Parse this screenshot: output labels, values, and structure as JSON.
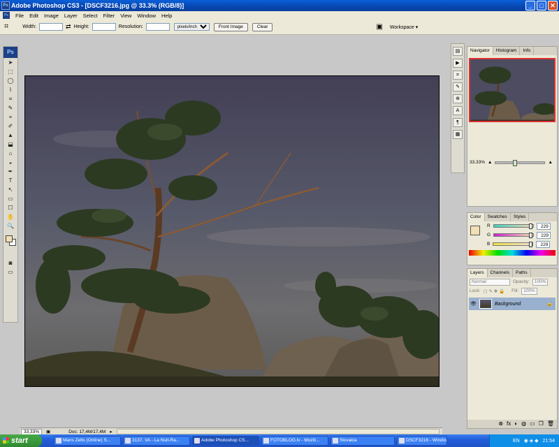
{
  "window": {
    "title": "Adobe Photoshop CS3 - [DSCF3216.jpg @ 33.3% (RGB/8)]",
    "min": "_",
    "max": "□",
    "close": "✕",
    "app_icon": "Ps"
  },
  "menu": [
    "File",
    "Edit",
    "Image",
    "Layer",
    "Select",
    "Filter",
    "View",
    "Window",
    "Help"
  ],
  "options": {
    "width_label": "Width:",
    "height_label": "Height:",
    "resolution_label": "Resolution:",
    "units": "pixels/inch",
    "front_image": "Front Image",
    "clear": "Clear",
    "workspace": "Workspace ▾"
  },
  "toolbox": {
    "logo": "Ps",
    "tools": [
      "➤",
      "⬚",
      "◯",
      "⌇",
      "⌗",
      "✎",
      "⌖",
      "✐",
      "▲",
      "⬓",
      "⌂",
      "◒",
      "✒",
      "T",
      "↖",
      "▭",
      "☐",
      "✋",
      "🔍"
    ]
  },
  "navigator": {
    "tabs": [
      "Navigator",
      "Histogram",
      "Info"
    ],
    "zoom": "33.33%",
    "zoom_fraction": 0.35
  },
  "color": {
    "tabs": [
      "Color",
      "Swatches",
      "Styles"
    ],
    "fg": "#f2dfb3",
    "channels": [
      {
        "label": "R",
        "value": "229",
        "fraction": 0.9,
        "gradient": "linear-gradient(90deg,#3fd3c2,#f0d8b0)"
      },
      {
        "label": "G",
        "value": "229",
        "fraction": 0.9,
        "gradient": "linear-gradient(90deg,#d020d0,#f0e0b0)"
      },
      {
        "label": "B",
        "value": "229",
        "fraction": 0.9,
        "gradient": "linear-gradient(90deg,#f0e040,#f0e0d0)"
      }
    ]
  },
  "layers": {
    "tabs": [
      "Layers",
      "Channels",
      "Paths"
    ],
    "blend_mode": "Normal",
    "opacity_label": "Opacity:",
    "opacity": "100%",
    "lock_label": "Lock:",
    "fill_label": "Fill:",
    "fill": "100%",
    "layer_name": "Background",
    "footer_icons": [
      "⊗",
      "fx",
      "◐",
      "◍",
      "▭",
      "❐",
      "🗑"
    ]
  },
  "status": {
    "zoom": "33,33%",
    "doc": "Doc: 17,4M/17,4M"
  },
  "taskbar": {
    "start": "start",
    "tasks": [
      "Mans Zelts (Online) S...",
      "3137. VA - La Nuit-Ra...",
      "Adobe Photoshop CS...",
      "FOTOBLOG.lv - Mozill...",
      "Slovakia",
      "DSCF3216 - Windows..."
    ],
    "lang": "EN",
    "clock": "21:54"
  }
}
